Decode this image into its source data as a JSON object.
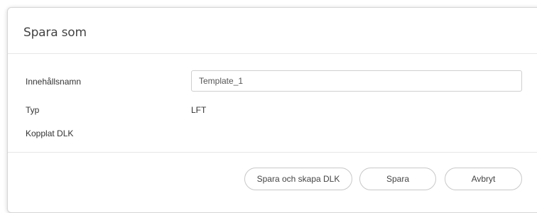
{
  "dialog": {
    "title": "Spara som"
  },
  "form": {
    "content_name": {
      "label": "Innehållsnamn",
      "value": "Template_1"
    },
    "type": {
      "label": "Typ",
      "value": "LFT"
    },
    "linked_dlk": {
      "label": "Kopplat DLK",
      "value": ""
    }
  },
  "footer": {
    "save_and_create_label": "Spara och skapa DLK",
    "save_label": "Spara",
    "cancel_label": "Avbryt"
  }
}
